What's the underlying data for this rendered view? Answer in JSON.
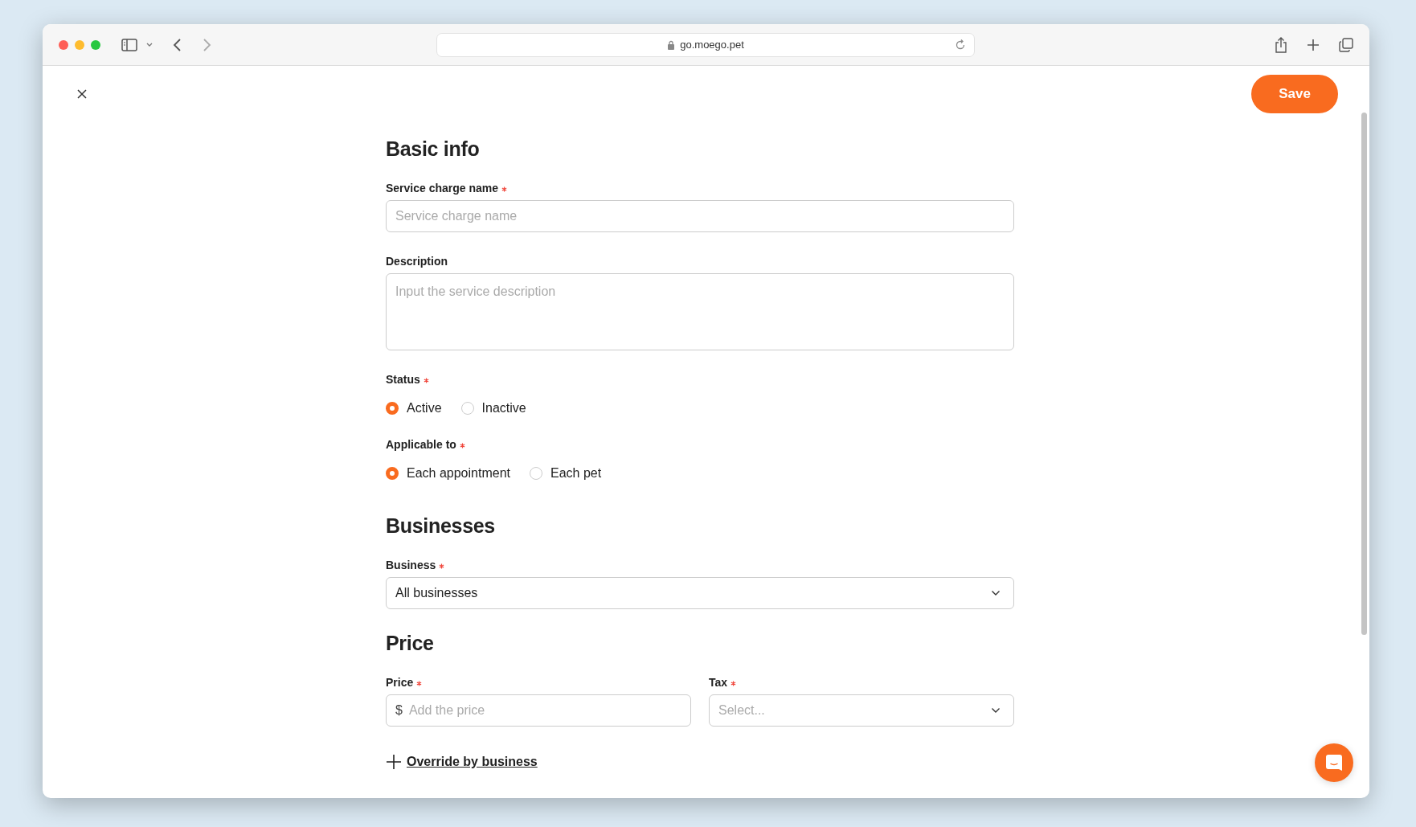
{
  "browser": {
    "url": "go.moego.pet"
  },
  "sections": [
    {
      "title": "Basic info",
      "fields": [
        {
          "kind": "text",
          "label": "Service charge name",
          "required": true,
          "placeholder": "Service charge name"
        },
        {
          "kind": "textarea",
          "label": "Description",
          "placeholder": "Input the service description"
        },
        {
          "kind": "radio",
          "label": "Status",
          "required": true,
          "options": [
            {
              "label": "Active",
              "selected": true
            },
            {
              "label": "Inactive",
              "selected": false
            }
          ]
        },
        {
          "kind": "radio",
          "label": "Applicable to",
          "required": true,
          "options": [
            {
              "label": "Each appointment",
              "selected": true
            },
            {
              "label": "Each pet",
              "selected": false
            }
          ]
        }
      ]
    },
    {
      "title": "Businesses",
      "fields": [
        {
          "kind": "select",
          "label": "Business",
          "required": true,
          "value": "All businesses"
        }
      ]
    },
    {
      "title": "Price",
      "fields": [
        {
          "kind": "pair",
          "fields": [
            {
              "kind": "text",
              "label": "Price",
              "required": true,
              "prefix": "$",
              "placeholder": "Add the price"
            },
            {
              "kind": "select",
              "label": "Tax",
              "required": true,
              "placeholder": "Select..."
            }
          ]
        }
      ]
    }
  ],
  "override_link": "Override by business",
  "save_button": "Save"
}
